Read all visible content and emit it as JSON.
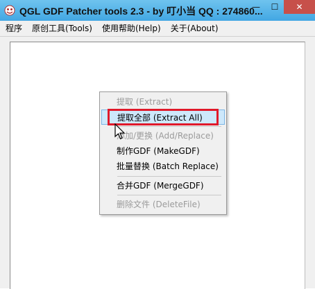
{
  "window": {
    "title": "QGL GDF Patcher tools 2.3 - by 叮小当 QQ : 274860...",
    "minimize_glyph": "—",
    "maximize_glyph": "☐",
    "close_glyph": "✕"
  },
  "menubar": {
    "items": [
      {
        "label": "程序"
      },
      {
        "label": "原创工具(Tools)"
      },
      {
        "label": "使用帮助(Help)"
      },
      {
        "label": "关于(About)"
      }
    ]
  },
  "context_menu": {
    "items": [
      {
        "label": "提取 (Extract)",
        "state": "disabled"
      },
      {
        "label": "提取全部 (Extract All)",
        "state": "highlighted"
      },
      {
        "label": "添加/更换 (Add/Replace)",
        "state": "disabled"
      },
      {
        "label": "制作GDF (MakeGDF)",
        "state": "enabled"
      },
      {
        "label": "批量替换 (Batch Replace)",
        "state": "enabled"
      },
      {
        "label": "合并GDF (MergeGDF)",
        "state": "enabled"
      },
      {
        "label": "删除文件 (DeleteFile)",
        "state": "disabled"
      }
    ]
  },
  "colors": {
    "titlebar": "#42a7e3",
    "close_button": "#c7504a",
    "highlight": "#cde8fb",
    "annotation_red": "#e0192a"
  },
  "icons": {
    "app": "app-icon",
    "cursor": "mouse-pointer-icon"
  }
}
